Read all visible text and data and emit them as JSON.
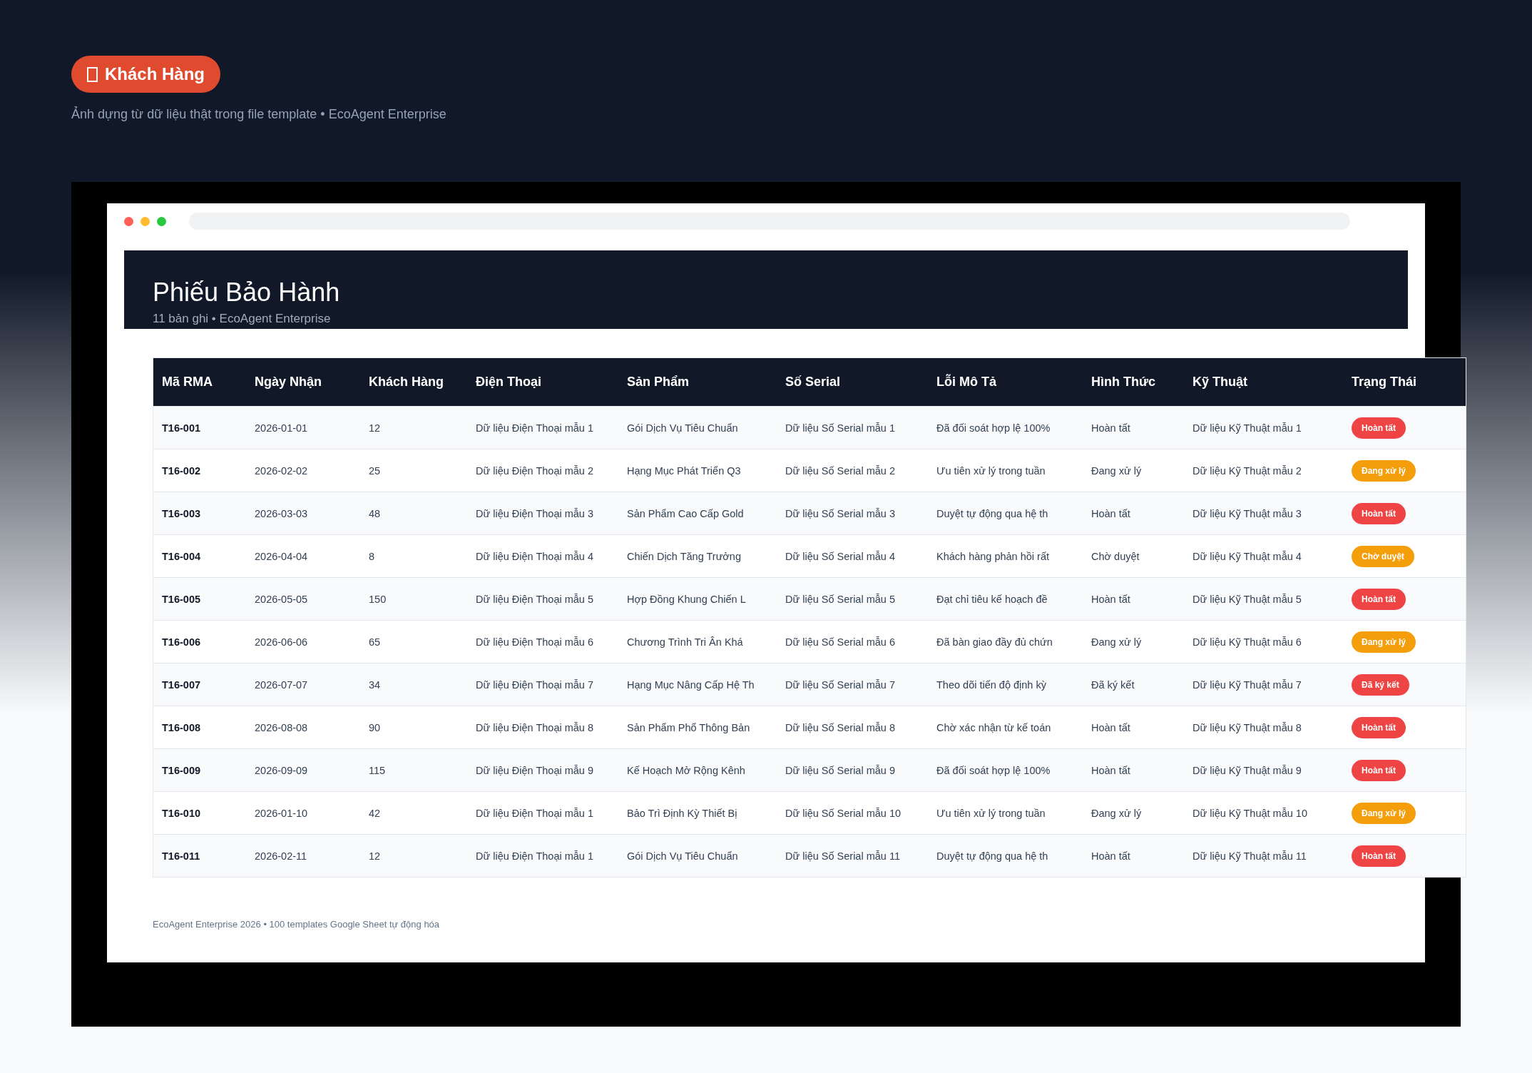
{
  "badge": {
    "label": "Khách Hàng"
  },
  "caption": "Ảnh dựng từ dữ liệu thật trong file template • EcoAgent Enterprise",
  "sheet": {
    "title": "Phiếu Bảo Hành",
    "subtitle": "11 bản ghi • EcoAgent Enterprise"
  },
  "table": {
    "columns": [
      "Mã RMA",
      "Ngày Nhận",
      "Khách Hàng",
      "Điện Thoại",
      "Sản Phẩm",
      "Số Serial",
      "Lỗi Mô Tả",
      "Hình Thức",
      "Kỹ Thuật",
      "Trạng Thái"
    ],
    "rows": [
      {
        "cells": [
          "T16-001",
          "2026-01-01",
          "12",
          "Dữ liệu Điện Thoại mẫu 1",
          "Gói Dịch Vụ Tiêu Chuẩn",
          "Dữ liệu Số Serial mẫu 1",
          "Đã đối soát hợp lệ 100%",
          "Hoàn tất",
          "Dữ liệu Kỹ Thuật mẫu 1"
        ],
        "status": {
          "text": "Hoàn tất",
          "color": "#ef4444"
        }
      },
      {
        "cells": [
          "T16-002",
          "2026-02-02",
          "25",
          "Dữ liệu Điện Thoại mẫu 2",
          "Hạng Mục Phát Triển Q3",
          "Dữ liệu Số Serial mẫu 2",
          "Ưu tiên xử lý trong tuần",
          "Đang xử lý",
          "Dữ liệu Kỹ Thuật mẫu 2"
        ],
        "status": {
          "text": "Đang xử lý",
          "color": "#f59e0b"
        }
      },
      {
        "cells": [
          "T16-003",
          "2026-03-03",
          "48",
          "Dữ liệu Điện Thoại mẫu 3",
          "Sản Phẩm Cao Cấp Gold",
          "Dữ liệu Số Serial mẫu 3",
          "Duyệt tự động qua hệ th",
          "Hoàn tất",
          "Dữ liệu Kỹ Thuật mẫu 3"
        ],
        "status": {
          "text": "Hoàn tất",
          "color": "#ef4444"
        }
      },
      {
        "cells": [
          "T16-004",
          "2026-04-04",
          "8",
          "Dữ liệu Điện Thoại mẫu 4",
          "Chiến Dịch Tăng Trưởng",
          "Dữ liệu Số Serial mẫu 4",
          "Khách hàng phản hồi rất",
          "Chờ duyệt",
          "Dữ liệu Kỹ Thuật mẫu 4"
        ],
        "status": {
          "text": "Chờ duyệt",
          "color": "#f59e0b"
        }
      },
      {
        "cells": [
          "T16-005",
          "2026-05-05",
          "150",
          "Dữ liệu Điện Thoại mẫu 5",
          "Hợp Đồng Khung Chiến L",
          "Dữ liệu Số Serial mẫu 5",
          "Đạt chỉ tiêu kế hoạch đề",
          "Hoàn tất",
          "Dữ liệu Kỹ Thuật mẫu 5"
        ],
        "status": {
          "text": "Hoàn tất",
          "color": "#ef4444"
        }
      },
      {
        "cells": [
          "T16-006",
          "2026-06-06",
          "65",
          "Dữ liệu Điện Thoại mẫu 6",
          "Chương Trình Tri Ân Khá",
          "Dữ liệu Số Serial mẫu 6",
          "Đã bàn giao đầy đủ chứn",
          "Đang xử lý",
          "Dữ liệu Kỹ Thuật mẫu 6"
        ],
        "status": {
          "text": "Đang xử lý",
          "color": "#f59e0b"
        }
      },
      {
        "cells": [
          "T16-007",
          "2026-07-07",
          "34",
          "Dữ liệu Điện Thoại mẫu 7",
          "Hạng Mục Nâng Cấp Hệ Th",
          "Dữ liệu Số Serial mẫu 7",
          "Theo dõi tiến độ định kỳ",
          "Đã ký kết",
          "Dữ liệu Kỹ Thuật mẫu 7"
        ],
        "status": {
          "text": "Đã ký kết",
          "color": "#ef4444"
        }
      },
      {
        "cells": [
          "T16-008",
          "2026-08-08",
          "90",
          "Dữ liệu Điện Thoại mẫu 8",
          "Sản Phẩm Phổ Thông Bản",
          "Dữ liệu Số Serial mẫu 8",
          "Chờ xác nhận từ kế toán",
          "Hoàn tất",
          "Dữ liệu Kỹ Thuật mẫu 8"
        ],
        "status": {
          "text": "Hoàn tất",
          "color": "#ef4444"
        }
      },
      {
        "cells": [
          "T16-009",
          "2026-09-09",
          "115",
          "Dữ liệu Điện Thoại mẫu 9",
          "Kế Hoạch Mở Rộng Kênh",
          "Dữ liệu Số Serial mẫu 9",
          "Đã đối soát hợp lệ 100%",
          "Hoàn tất",
          "Dữ liệu Kỹ Thuật mẫu 9"
        ],
        "status": {
          "text": "Hoàn tất",
          "color": "#ef4444"
        }
      },
      {
        "cells": [
          "T16-010",
          "2026-01-10",
          "42",
          "Dữ liệu Điện Thoại mẫu 1",
          "Bảo Trì Định Kỳ Thiết Bị",
          "Dữ liệu Số Serial mẫu 10",
          "Ưu tiên xử lý trong tuần",
          "Đang xử lý",
          "Dữ liệu Kỹ Thuật mẫu 10"
        ],
        "status": {
          "text": "Đang xử lý",
          "color": "#f59e0b"
        }
      },
      {
        "cells": [
          "T16-011",
          "2026-02-11",
          "12",
          "Dữ liệu Điện Thoại mẫu 1",
          "Gói Dịch Vụ Tiêu Chuẩn",
          "Dữ liệu Số Serial mẫu 11",
          "Duyệt tự động qua hệ th",
          "Hoàn tất",
          "Dữ liệu Kỹ Thuật mẫu 11"
        ],
        "status": {
          "text": "Hoàn tất",
          "color": "#ef4444"
        }
      }
    ]
  },
  "footer": "EcoAgent Enterprise 2026 • 100 templates Google Sheet tự động hóa"
}
